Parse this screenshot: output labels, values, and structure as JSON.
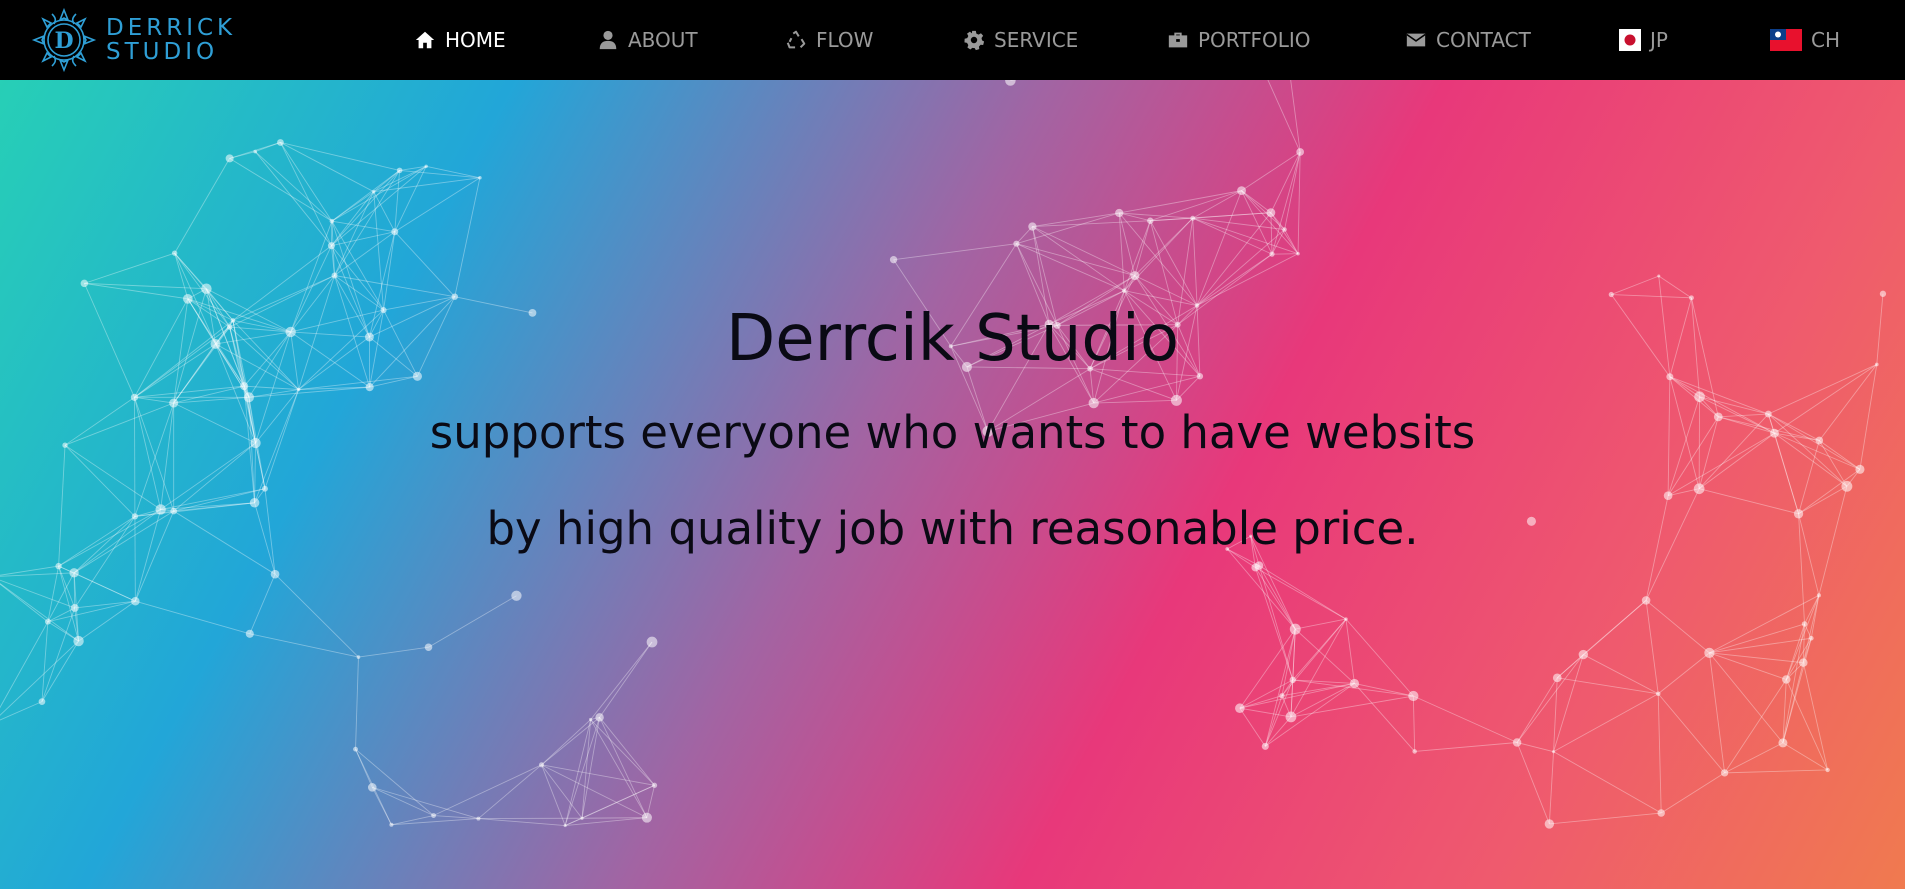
{
  "brand": {
    "logo_letter": "D",
    "line1": "DERRICK",
    "line2": "STUDIO",
    "accent_color": "#2f9fd6"
  },
  "nav": {
    "items": [
      {
        "label": "HOME",
        "icon": "home-icon",
        "active": true
      },
      {
        "label": "ABOUT",
        "icon": "user-icon",
        "active": false
      },
      {
        "label": "FLOW",
        "icon": "recycle-icon",
        "active": false
      },
      {
        "label": "SERVICE",
        "icon": "gear-icon",
        "active": false
      },
      {
        "label": "PORTFOLIO",
        "icon": "briefcase-icon",
        "active": false
      },
      {
        "label": "CONTACT",
        "icon": "envelope-icon",
        "active": false
      }
    ],
    "languages": [
      {
        "label": "JP",
        "icon": "japan-flag-icon"
      },
      {
        "label": "CH",
        "icon": "taiwan-flag-icon"
      }
    ],
    "active_color": "#ffffff",
    "inactive_color": "#9a9a9a"
  },
  "hero": {
    "title": "Derrcik Studio",
    "line1": "supports everyone who wants to have websits",
    "line2": "by high quality job with reasonable price.",
    "gradient_colors": [
      "#27cfb6",
      "#22a6d8",
      "#a264a3",
      "#e8387a",
      "#f07a4f"
    ]
  }
}
